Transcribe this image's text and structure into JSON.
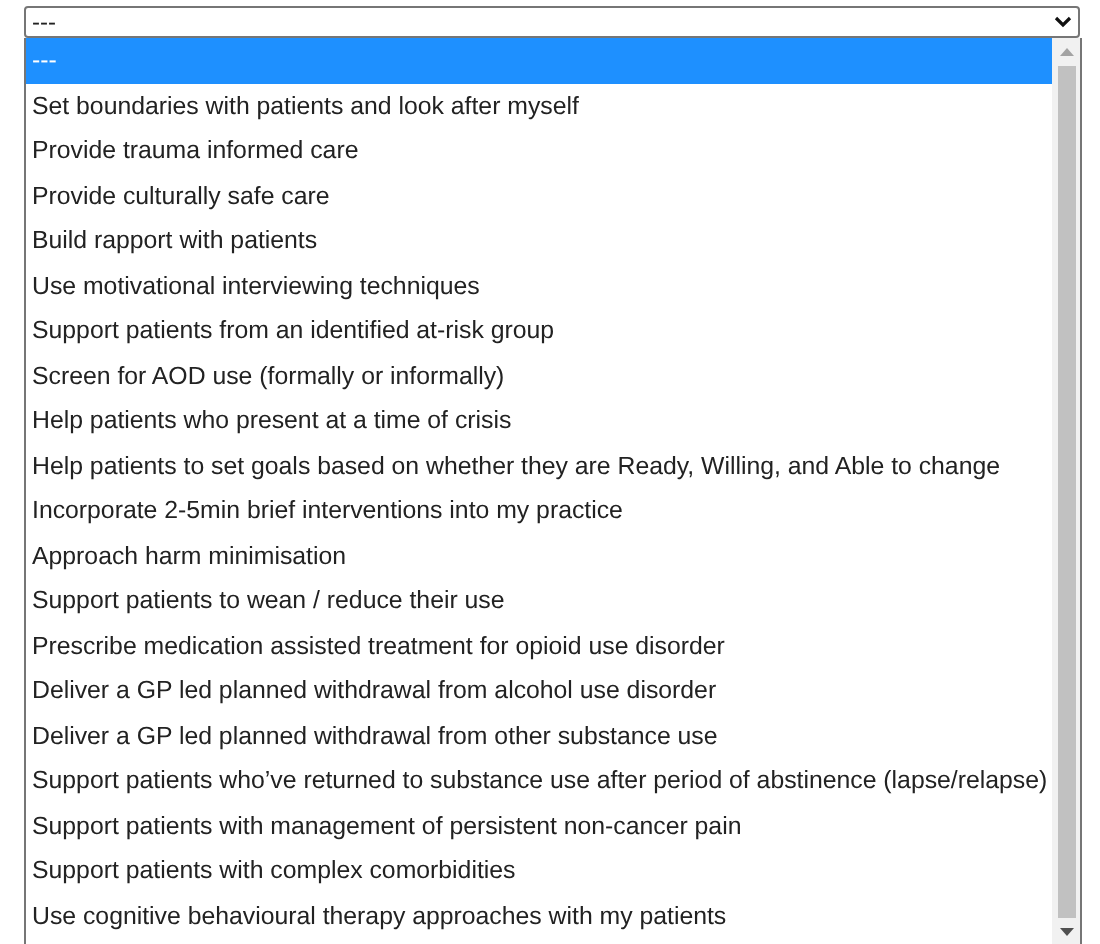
{
  "select": {
    "value": "---"
  },
  "options": [
    {
      "label": "---",
      "selected": true
    },
    {
      "label": "Set boundaries with patients and look after myself",
      "selected": false
    },
    {
      "label": "Provide trauma informed care",
      "selected": false
    },
    {
      "label": "Provide culturally safe care",
      "selected": false
    },
    {
      "label": "Build rapport with patients",
      "selected": false
    },
    {
      "label": "Use motivational interviewing techniques",
      "selected": false
    },
    {
      "label": "Support patients from an identified at-risk group",
      "selected": false
    },
    {
      "label": "Screen for AOD use (formally or informally)",
      "selected": false
    },
    {
      "label": "Help patients who present at a time of crisis",
      "selected": false
    },
    {
      "label": "Help patients to set goals based on whether they are Ready, Willing, and Able to change",
      "selected": false
    },
    {
      "label": "Incorporate 2-5min brief interventions into my practice",
      "selected": false
    },
    {
      "label": "Approach harm minimisation",
      "selected": false
    },
    {
      "label": "Support patients to wean / reduce their use",
      "selected": false
    },
    {
      "label": "Prescribe medication assisted treatment for opioid use disorder",
      "selected": false
    },
    {
      "label": "Deliver a GP led planned withdrawal from alcohol use disorder",
      "selected": false
    },
    {
      "label": "Deliver a GP led planned withdrawal from other substance use",
      "selected": false
    },
    {
      "label": "Support patients who’ve returned to substance use after period of abstinence (lapse/relapse)",
      "selected": false
    },
    {
      "label": "Support patients with management of persistent non-cancer pain",
      "selected": false
    },
    {
      "label": "Support patients with complex comorbidities",
      "selected": false
    },
    {
      "label": "Use cognitive behavioural therapy approaches with my patients",
      "selected": false
    }
  ]
}
